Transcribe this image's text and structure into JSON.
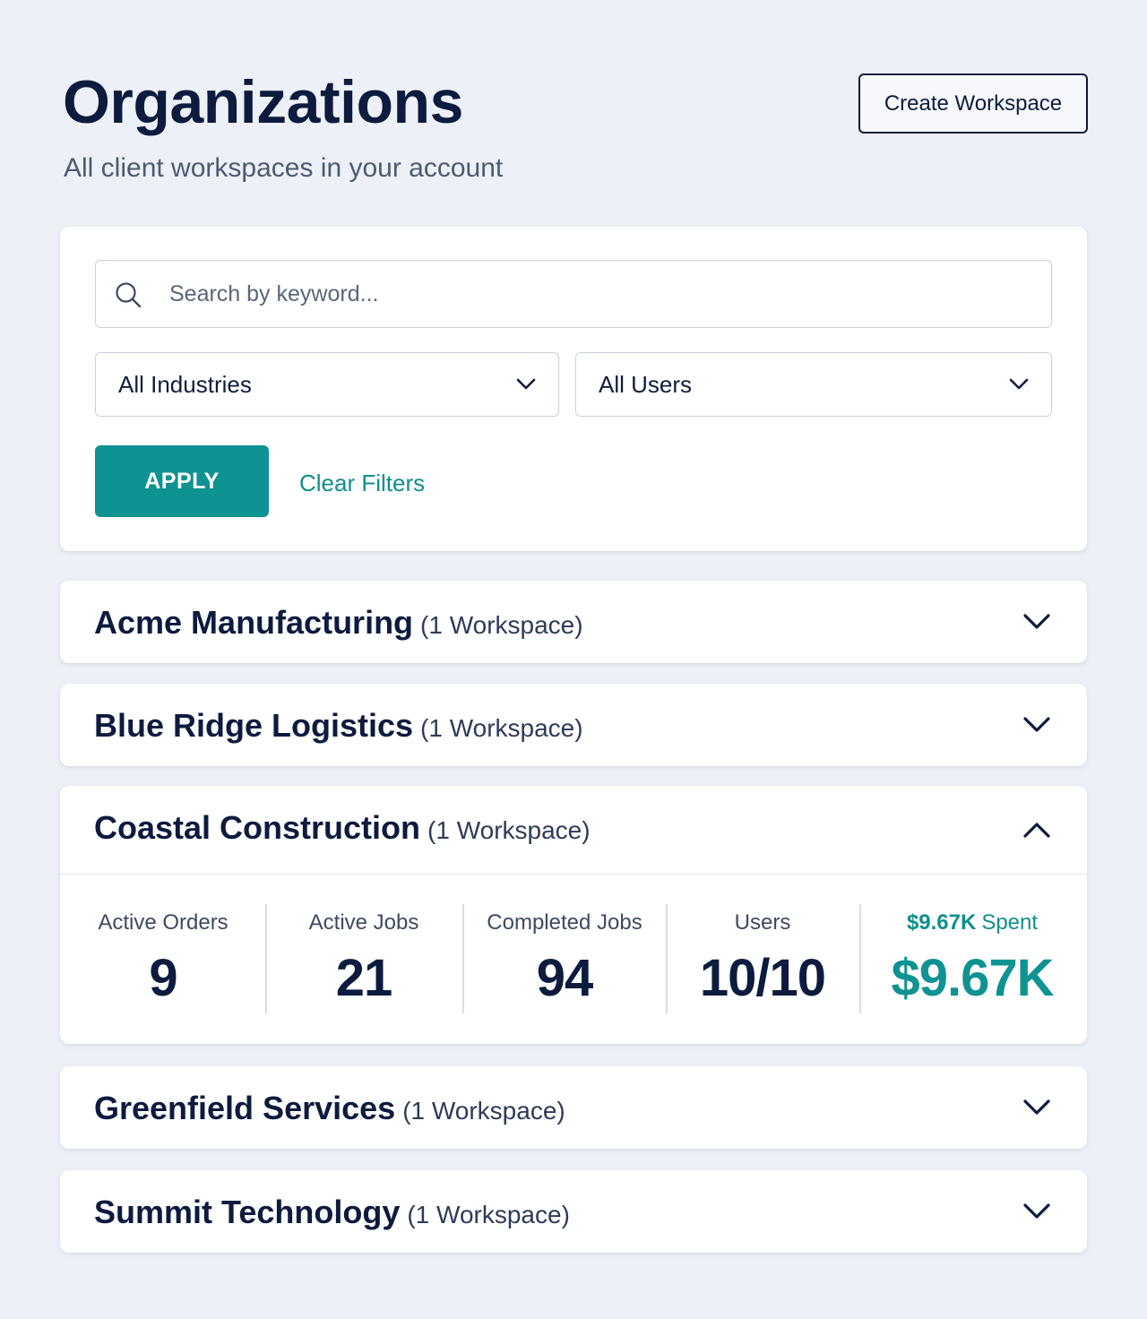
{
  "header": {
    "title": "Organizations",
    "subtitle": "All client workspaces in your account",
    "create_button": "Create Workspace"
  },
  "filters": {
    "search_placeholder": "Search by keyword...",
    "industry_select": "All Industries",
    "users_select": "All Users",
    "apply_label": "APPLY",
    "clear_label": "Clear Filters"
  },
  "organizations": [
    {
      "name": "Acme Manufacturing",
      "count": "(1 Workspace)",
      "expanded": false
    },
    {
      "name": "Blue Ridge Logistics",
      "count": "(1 Workspace)",
      "expanded": false
    },
    {
      "name": "Coastal Construction",
      "count": "(1 Workspace)",
      "expanded": true,
      "stats": {
        "active_orders_label": "Active Orders",
        "active_orders": "9",
        "active_jobs_label": "Active Jobs",
        "active_jobs": "21",
        "completed_jobs_label": "Completed Jobs",
        "completed_jobs": "94",
        "users_label": "Users",
        "users": "10/10",
        "spent_amount": "$9.67K",
        "spent_label": "Spent",
        "spent_value": "$9.67K"
      }
    },
    {
      "name": "Greenfield Services",
      "count": "(1 Workspace)",
      "expanded": false
    },
    {
      "name": "Summit Technology",
      "count": "(1 Workspace)",
      "expanded": false
    }
  ],
  "icons": {
    "search": "search-icon",
    "dropdown": "chevron-down-icon",
    "expand": "chevron-down-icon",
    "collapse": "chevron-up-icon"
  },
  "colors": {
    "accent": "#0f9292",
    "primary_text": "#0d1b3e",
    "background": "#edf1f7"
  }
}
